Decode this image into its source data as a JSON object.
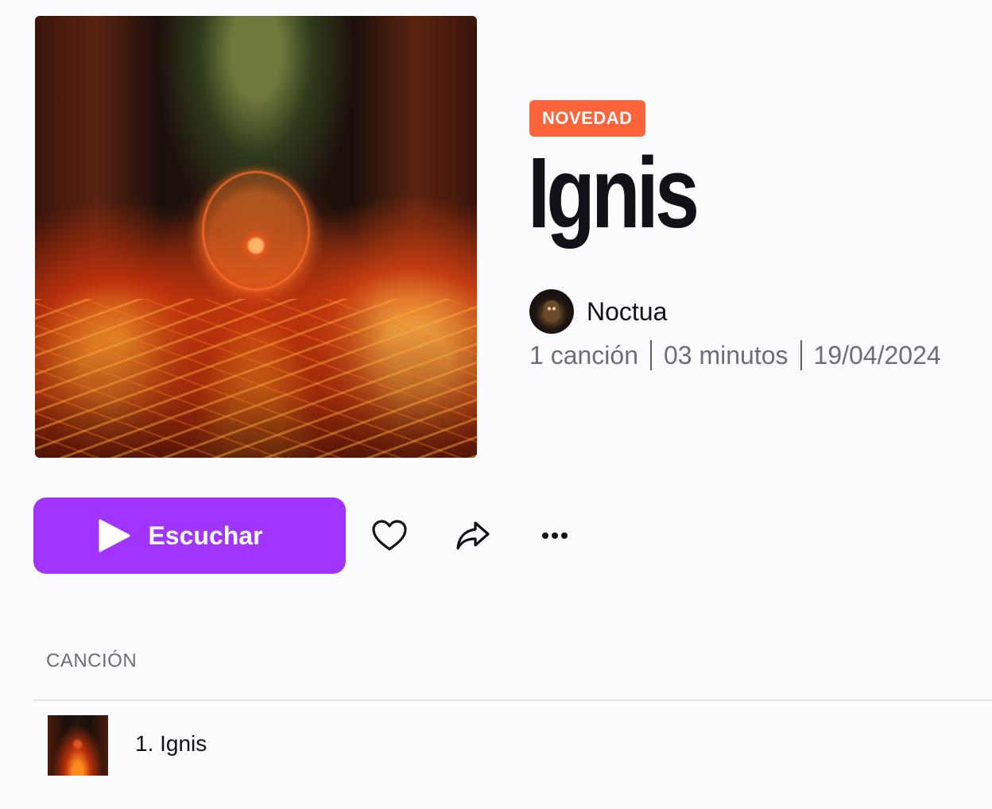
{
  "album": {
    "badge": "NOVEDAD",
    "title": "Ignis",
    "artist": "Noctua",
    "meta": {
      "songs": "1 canción",
      "duration": "03 minutos",
      "date": "19/04/2024"
    }
  },
  "actions": {
    "play_label": "Escuchar",
    "like_icon": "heart-icon",
    "share_icon": "share-icon",
    "more_icon": "more-icon"
  },
  "tracklist": {
    "header": "CANCIÓN",
    "tracks": [
      {
        "title": "1. Ignis"
      }
    ]
  },
  "colors": {
    "badge": "#ff6339",
    "play_button": "#a134ff",
    "background": "#fcfbfe"
  }
}
